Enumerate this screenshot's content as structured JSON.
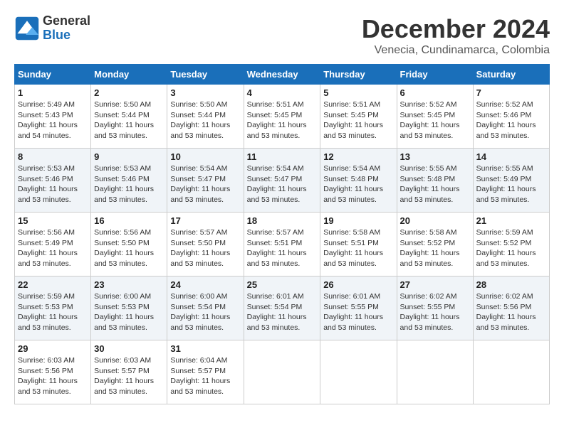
{
  "logo": {
    "line1": "General",
    "line2": "Blue"
  },
  "title": "December 2024",
  "location": "Venecia, Cundinamarca, Colombia",
  "days_of_week": [
    "Sunday",
    "Monday",
    "Tuesday",
    "Wednesday",
    "Thursday",
    "Friday",
    "Saturday"
  ],
  "weeks": [
    [
      {
        "day": "1",
        "sunrise": "5:49 AM",
        "sunset": "5:43 PM",
        "daylight": "11 hours and 54 minutes."
      },
      {
        "day": "2",
        "sunrise": "5:50 AM",
        "sunset": "5:44 PM",
        "daylight": "11 hours and 53 minutes."
      },
      {
        "day": "3",
        "sunrise": "5:50 AM",
        "sunset": "5:44 PM",
        "daylight": "11 hours and 53 minutes."
      },
      {
        "day": "4",
        "sunrise": "5:51 AM",
        "sunset": "5:45 PM",
        "daylight": "11 hours and 53 minutes."
      },
      {
        "day": "5",
        "sunrise": "5:51 AM",
        "sunset": "5:45 PM",
        "daylight": "11 hours and 53 minutes."
      },
      {
        "day": "6",
        "sunrise": "5:52 AM",
        "sunset": "5:45 PM",
        "daylight": "11 hours and 53 minutes."
      },
      {
        "day": "7",
        "sunrise": "5:52 AM",
        "sunset": "5:46 PM",
        "daylight": "11 hours and 53 minutes."
      }
    ],
    [
      {
        "day": "8",
        "sunrise": "5:53 AM",
        "sunset": "5:46 PM",
        "daylight": "11 hours and 53 minutes."
      },
      {
        "day": "9",
        "sunrise": "5:53 AM",
        "sunset": "5:46 PM",
        "daylight": "11 hours and 53 minutes."
      },
      {
        "day": "10",
        "sunrise": "5:54 AM",
        "sunset": "5:47 PM",
        "daylight": "11 hours and 53 minutes."
      },
      {
        "day": "11",
        "sunrise": "5:54 AM",
        "sunset": "5:47 PM",
        "daylight": "11 hours and 53 minutes."
      },
      {
        "day": "12",
        "sunrise": "5:54 AM",
        "sunset": "5:48 PM",
        "daylight": "11 hours and 53 minutes."
      },
      {
        "day": "13",
        "sunrise": "5:55 AM",
        "sunset": "5:48 PM",
        "daylight": "11 hours and 53 minutes."
      },
      {
        "day": "14",
        "sunrise": "5:55 AM",
        "sunset": "5:49 PM",
        "daylight": "11 hours and 53 minutes."
      }
    ],
    [
      {
        "day": "15",
        "sunrise": "5:56 AM",
        "sunset": "5:49 PM",
        "daylight": "11 hours and 53 minutes."
      },
      {
        "day": "16",
        "sunrise": "5:56 AM",
        "sunset": "5:50 PM",
        "daylight": "11 hours and 53 minutes."
      },
      {
        "day": "17",
        "sunrise": "5:57 AM",
        "sunset": "5:50 PM",
        "daylight": "11 hours and 53 minutes."
      },
      {
        "day": "18",
        "sunrise": "5:57 AM",
        "sunset": "5:51 PM",
        "daylight": "11 hours and 53 minutes."
      },
      {
        "day": "19",
        "sunrise": "5:58 AM",
        "sunset": "5:51 PM",
        "daylight": "11 hours and 53 minutes."
      },
      {
        "day": "20",
        "sunrise": "5:58 AM",
        "sunset": "5:52 PM",
        "daylight": "11 hours and 53 minutes."
      },
      {
        "day": "21",
        "sunrise": "5:59 AM",
        "sunset": "5:52 PM",
        "daylight": "11 hours and 53 minutes."
      }
    ],
    [
      {
        "day": "22",
        "sunrise": "5:59 AM",
        "sunset": "5:53 PM",
        "daylight": "11 hours and 53 minutes."
      },
      {
        "day": "23",
        "sunrise": "6:00 AM",
        "sunset": "5:53 PM",
        "daylight": "11 hours and 53 minutes."
      },
      {
        "day": "24",
        "sunrise": "6:00 AM",
        "sunset": "5:54 PM",
        "daylight": "11 hours and 53 minutes."
      },
      {
        "day": "25",
        "sunrise": "6:01 AM",
        "sunset": "5:54 PM",
        "daylight": "11 hours and 53 minutes."
      },
      {
        "day": "26",
        "sunrise": "6:01 AM",
        "sunset": "5:55 PM",
        "daylight": "11 hours and 53 minutes."
      },
      {
        "day": "27",
        "sunrise": "6:02 AM",
        "sunset": "5:55 PM",
        "daylight": "11 hours and 53 minutes."
      },
      {
        "day": "28",
        "sunrise": "6:02 AM",
        "sunset": "5:56 PM",
        "daylight": "11 hours and 53 minutes."
      }
    ],
    [
      {
        "day": "29",
        "sunrise": "6:03 AM",
        "sunset": "5:56 PM",
        "daylight": "11 hours and 53 minutes."
      },
      {
        "day": "30",
        "sunrise": "6:03 AM",
        "sunset": "5:57 PM",
        "daylight": "11 hours and 53 minutes."
      },
      {
        "day": "31",
        "sunrise": "6:04 AM",
        "sunset": "5:57 PM",
        "daylight": "11 hours and 53 minutes."
      },
      null,
      null,
      null,
      null
    ]
  ]
}
